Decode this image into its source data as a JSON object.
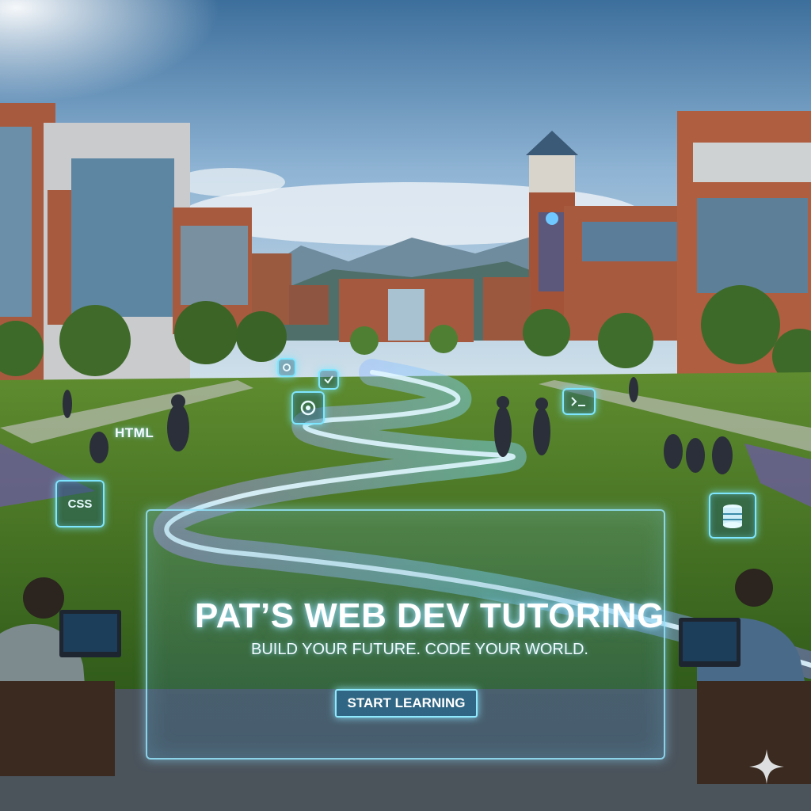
{
  "hero": {
    "title": "PAT’S WEB DEV TUTORING",
    "subtitle": "BUILD YOUR FUTURE. CODE YOUR WORLD.",
    "button_label": "START LEARNING"
  },
  "floating_labels": {
    "html": "HTML",
    "css": "CSS"
  },
  "icons": [
    "code-chip-icon",
    "database-icon",
    "target-icon",
    "checklist-icon",
    "terminal-icon",
    "sparkle-icon"
  ],
  "colors": {
    "accent_glow": "#7fe6ff",
    "path_glow": "#8a7cff",
    "panel_border": "#96e6ff"
  }
}
